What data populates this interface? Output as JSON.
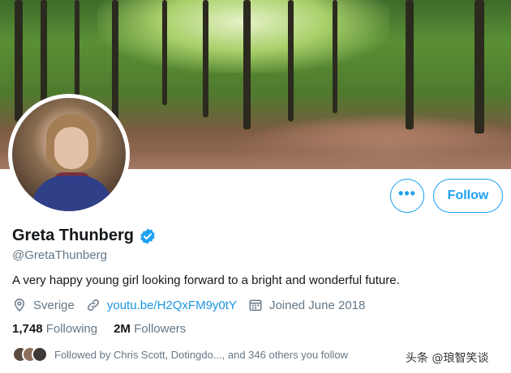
{
  "profile": {
    "display_name": "Greta Thunberg",
    "handle": "@GretaThunberg",
    "bio": "A very happy young girl looking forward to a bright and wonderful future.",
    "location": "Sverige",
    "website": "youtu.be/H2QxFM9y0tY",
    "joined": "Joined June 2018",
    "verified": true
  },
  "actions": {
    "more_label": "•••",
    "follow_label": "Follow"
  },
  "stats": {
    "following_count": "1,748",
    "following_label": "Following",
    "followers_count": "2M",
    "followers_label": "Followers"
  },
  "followed_by": {
    "text": "Followed by Chris Scott, Dotingdo..., and 346 others you follow"
  },
  "watermark": {
    "text": "头条 @琅智笑谈"
  },
  "colors": {
    "accent": "#1da1f2",
    "link": "#1b95e0",
    "secondary_text": "#657786"
  },
  "icons": [
    "more-icon",
    "verified-badge-icon",
    "location-icon",
    "link-icon",
    "calendar-icon"
  ]
}
